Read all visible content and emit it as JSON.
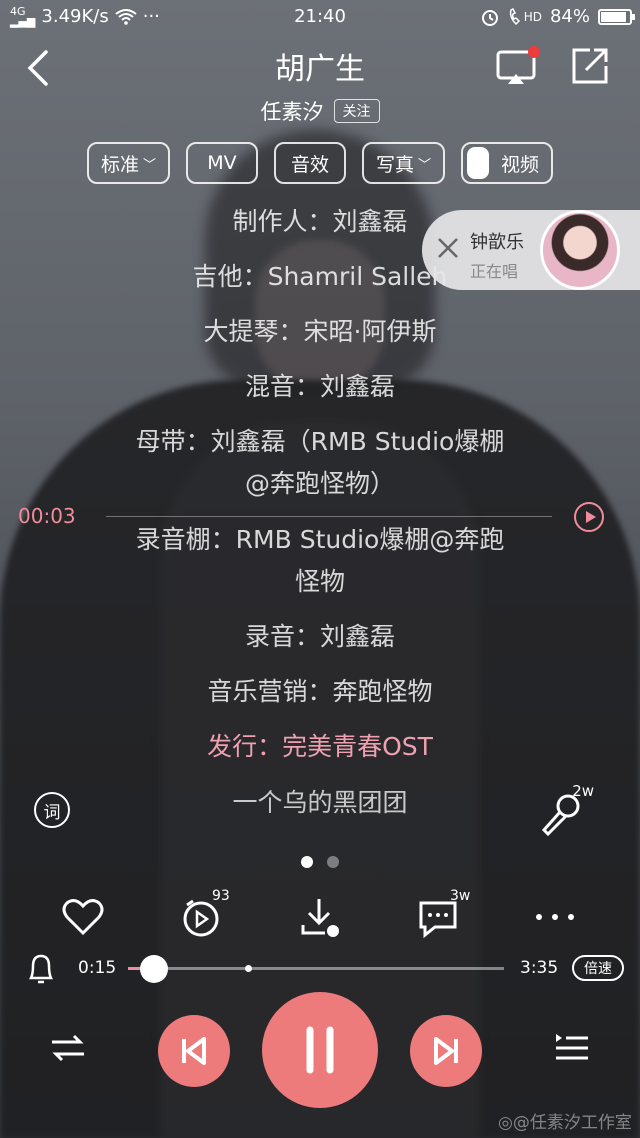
{
  "status_bar": {
    "network": "3.49K/s",
    "signal_label": "4G",
    "more": "···",
    "time": "21:40",
    "hd_label": "HD",
    "battery": "84%",
    "battery_level": 0.84
  },
  "header": {
    "title": "胡广生",
    "artist": "任素汐",
    "follow_label": "关注",
    "cast_has_notification": true
  },
  "options": [
    {
      "label": "标准",
      "dropdown": true
    },
    {
      "label": "MV",
      "dropdown": false
    },
    {
      "label": "音效",
      "dropdown": false
    },
    {
      "label": "写真",
      "dropdown": true
    },
    {
      "label": "视频",
      "toggle": true
    }
  ],
  "lyrics": [
    "制作人：刘鑫磊",
    "吉他：Shamril Salleh",
    "大提琴：宋昭·阿伊斯",
    "混音：刘鑫磊",
    "母带：刘鑫磊（RMB Studio爆棚",
    "@奔跑怪物）",
    "录音棚：RMB Studio爆棚@奔跑",
    "怪物",
    "录音：刘鑫磊",
    "音乐营销：奔跑怪物",
    "发行：完美青春OST",
    "一个乌的黑团团"
  ],
  "active_lyric_index": 10,
  "scrub_time": "00:03",
  "floating_card": {
    "name": "钟歆乐",
    "status": "正在唱"
  },
  "side": {
    "lyric_icon_label": "词",
    "mic_count": "2w"
  },
  "pager": {
    "count": 2,
    "active": 0
  },
  "actions": {
    "timer_count": "93",
    "comment_count": "3w"
  },
  "progress": {
    "current": "0:15",
    "total": "3:35",
    "fraction": 0.07,
    "buffered": 0.32
  },
  "speed_label": "倍速",
  "watermark": "@任素汐工作室",
  "colors": {
    "accent": "#ee7b7b",
    "active_lyric": "#f0a0b0"
  }
}
